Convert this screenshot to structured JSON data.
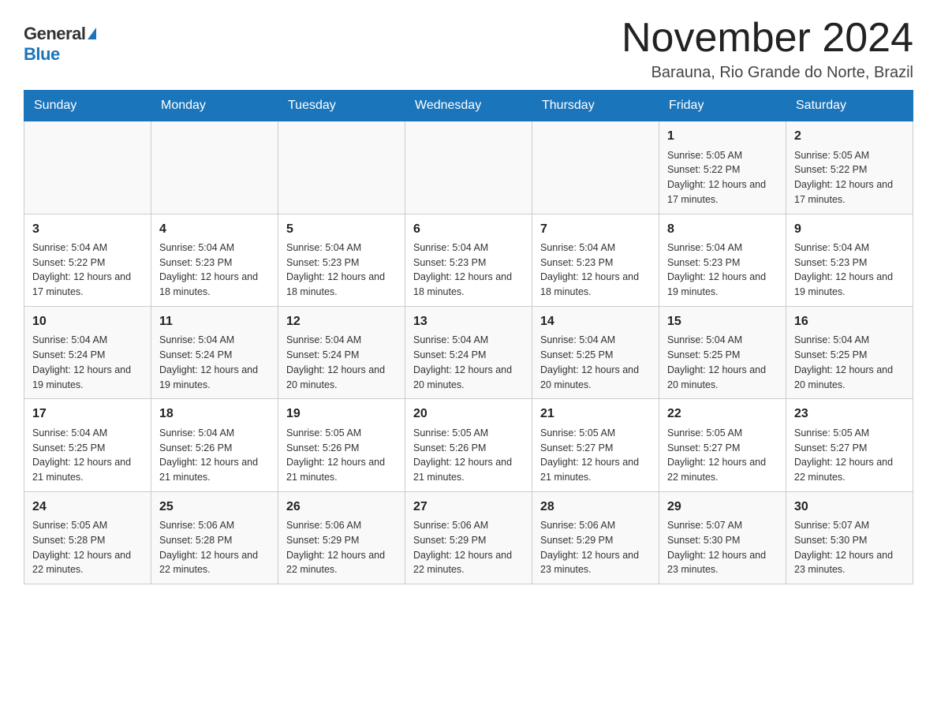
{
  "header": {
    "logo_general": "General",
    "logo_blue": "Blue",
    "month_title": "November 2024",
    "location": "Barauna, Rio Grande do Norte, Brazil"
  },
  "days_of_week": [
    "Sunday",
    "Monday",
    "Tuesday",
    "Wednesday",
    "Thursday",
    "Friday",
    "Saturday"
  ],
  "weeks": [
    [
      {
        "day": "",
        "sunrise": "",
        "sunset": "",
        "daylight": ""
      },
      {
        "day": "",
        "sunrise": "",
        "sunset": "",
        "daylight": ""
      },
      {
        "day": "",
        "sunrise": "",
        "sunset": "",
        "daylight": ""
      },
      {
        "day": "",
        "sunrise": "",
        "sunset": "",
        "daylight": ""
      },
      {
        "day": "",
        "sunrise": "",
        "sunset": "",
        "daylight": ""
      },
      {
        "day": "1",
        "sunrise": "Sunrise: 5:05 AM",
        "sunset": "Sunset: 5:22 PM",
        "daylight": "Daylight: 12 hours and 17 minutes."
      },
      {
        "day": "2",
        "sunrise": "Sunrise: 5:05 AM",
        "sunset": "Sunset: 5:22 PM",
        "daylight": "Daylight: 12 hours and 17 minutes."
      }
    ],
    [
      {
        "day": "3",
        "sunrise": "Sunrise: 5:04 AM",
        "sunset": "Sunset: 5:22 PM",
        "daylight": "Daylight: 12 hours and 17 minutes."
      },
      {
        "day": "4",
        "sunrise": "Sunrise: 5:04 AM",
        "sunset": "Sunset: 5:23 PM",
        "daylight": "Daylight: 12 hours and 18 minutes."
      },
      {
        "day": "5",
        "sunrise": "Sunrise: 5:04 AM",
        "sunset": "Sunset: 5:23 PM",
        "daylight": "Daylight: 12 hours and 18 minutes."
      },
      {
        "day": "6",
        "sunrise": "Sunrise: 5:04 AM",
        "sunset": "Sunset: 5:23 PM",
        "daylight": "Daylight: 12 hours and 18 minutes."
      },
      {
        "day": "7",
        "sunrise": "Sunrise: 5:04 AM",
        "sunset": "Sunset: 5:23 PM",
        "daylight": "Daylight: 12 hours and 18 minutes."
      },
      {
        "day": "8",
        "sunrise": "Sunrise: 5:04 AM",
        "sunset": "Sunset: 5:23 PM",
        "daylight": "Daylight: 12 hours and 19 minutes."
      },
      {
        "day": "9",
        "sunrise": "Sunrise: 5:04 AM",
        "sunset": "Sunset: 5:23 PM",
        "daylight": "Daylight: 12 hours and 19 minutes."
      }
    ],
    [
      {
        "day": "10",
        "sunrise": "Sunrise: 5:04 AM",
        "sunset": "Sunset: 5:24 PM",
        "daylight": "Daylight: 12 hours and 19 minutes."
      },
      {
        "day": "11",
        "sunrise": "Sunrise: 5:04 AM",
        "sunset": "Sunset: 5:24 PM",
        "daylight": "Daylight: 12 hours and 19 minutes."
      },
      {
        "day": "12",
        "sunrise": "Sunrise: 5:04 AM",
        "sunset": "Sunset: 5:24 PM",
        "daylight": "Daylight: 12 hours and 20 minutes."
      },
      {
        "day": "13",
        "sunrise": "Sunrise: 5:04 AM",
        "sunset": "Sunset: 5:24 PM",
        "daylight": "Daylight: 12 hours and 20 minutes."
      },
      {
        "day": "14",
        "sunrise": "Sunrise: 5:04 AM",
        "sunset": "Sunset: 5:25 PM",
        "daylight": "Daylight: 12 hours and 20 minutes."
      },
      {
        "day": "15",
        "sunrise": "Sunrise: 5:04 AM",
        "sunset": "Sunset: 5:25 PM",
        "daylight": "Daylight: 12 hours and 20 minutes."
      },
      {
        "day": "16",
        "sunrise": "Sunrise: 5:04 AM",
        "sunset": "Sunset: 5:25 PM",
        "daylight": "Daylight: 12 hours and 20 minutes."
      }
    ],
    [
      {
        "day": "17",
        "sunrise": "Sunrise: 5:04 AM",
        "sunset": "Sunset: 5:25 PM",
        "daylight": "Daylight: 12 hours and 21 minutes."
      },
      {
        "day": "18",
        "sunrise": "Sunrise: 5:04 AM",
        "sunset": "Sunset: 5:26 PM",
        "daylight": "Daylight: 12 hours and 21 minutes."
      },
      {
        "day": "19",
        "sunrise": "Sunrise: 5:05 AM",
        "sunset": "Sunset: 5:26 PM",
        "daylight": "Daylight: 12 hours and 21 minutes."
      },
      {
        "day": "20",
        "sunrise": "Sunrise: 5:05 AM",
        "sunset": "Sunset: 5:26 PM",
        "daylight": "Daylight: 12 hours and 21 minutes."
      },
      {
        "day": "21",
        "sunrise": "Sunrise: 5:05 AM",
        "sunset": "Sunset: 5:27 PM",
        "daylight": "Daylight: 12 hours and 21 minutes."
      },
      {
        "day": "22",
        "sunrise": "Sunrise: 5:05 AM",
        "sunset": "Sunset: 5:27 PM",
        "daylight": "Daylight: 12 hours and 22 minutes."
      },
      {
        "day": "23",
        "sunrise": "Sunrise: 5:05 AM",
        "sunset": "Sunset: 5:27 PM",
        "daylight": "Daylight: 12 hours and 22 minutes."
      }
    ],
    [
      {
        "day": "24",
        "sunrise": "Sunrise: 5:05 AM",
        "sunset": "Sunset: 5:28 PM",
        "daylight": "Daylight: 12 hours and 22 minutes."
      },
      {
        "day": "25",
        "sunrise": "Sunrise: 5:06 AM",
        "sunset": "Sunset: 5:28 PM",
        "daylight": "Daylight: 12 hours and 22 minutes."
      },
      {
        "day": "26",
        "sunrise": "Sunrise: 5:06 AM",
        "sunset": "Sunset: 5:29 PM",
        "daylight": "Daylight: 12 hours and 22 minutes."
      },
      {
        "day": "27",
        "sunrise": "Sunrise: 5:06 AM",
        "sunset": "Sunset: 5:29 PM",
        "daylight": "Daylight: 12 hours and 22 minutes."
      },
      {
        "day": "28",
        "sunrise": "Sunrise: 5:06 AM",
        "sunset": "Sunset: 5:29 PM",
        "daylight": "Daylight: 12 hours and 23 minutes."
      },
      {
        "day": "29",
        "sunrise": "Sunrise: 5:07 AM",
        "sunset": "Sunset: 5:30 PM",
        "daylight": "Daylight: 12 hours and 23 minutes."
      },
      {
        "day": "30",
        "sunrise": "Sunrise: 5:07 AM",
        "sunset": "Sunset: 5:30 PM",
        "daylight": "Daylight: 12 hours and 23 minutes."
      }
    ]
  ]
}
